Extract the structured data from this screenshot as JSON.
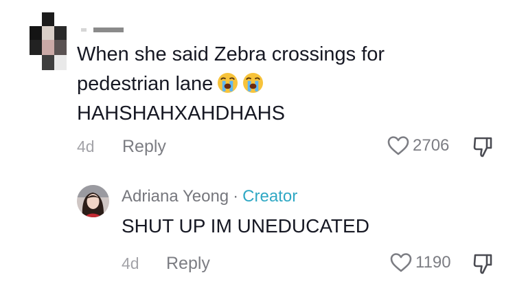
{
  "comment": {
    "text_lines": [
      "When she said Zebra crossings for",
      "pedestrian lane",
      "HAHSHAHXAHDHAHS"
    ],
    "emojis": [
      "loudly-crying-face",
      "loudly-crying-face"
    ],
    "date": "4d",
    "reply_label": "Reply",
    "like_count": "2706"
  },
  "reply": {
    "author": "Adriana Yeong",
    "separator": "·",
    "badge": "Creator",
    "text": "SHUT UP IM UNEDUCATED",
    "date": "4d",
    "reply_label": "Reply",
    "like_count": "1190"
  },
  "colors": {
    "text": "#161823",
    "muted": "#7c7d83",
    "creator_badge": "#2fa8c4"
  },
  "icons": [
    "heart-outline-icon",
    "dislike-icon",
    "loudly-crying-face-emoji"
  ]
}
